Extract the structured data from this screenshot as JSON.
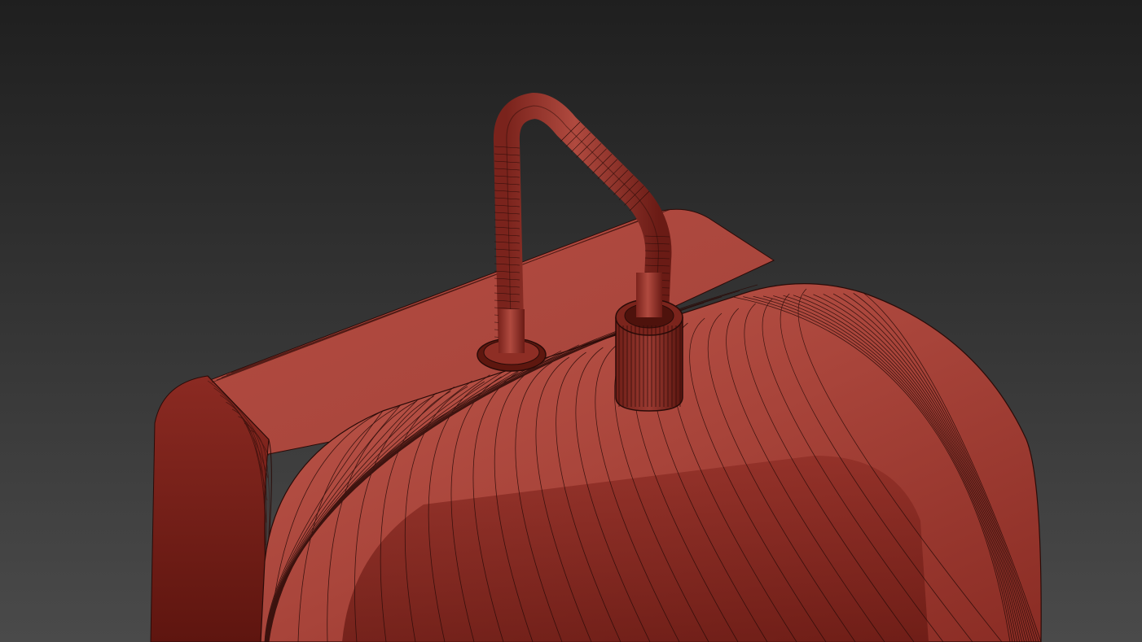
{
  "scene": {
    "subject": "wireframe-over-shaded-red-object-with-handle",
    "colors": {
      "background_top": "#1f1f1f",
      "background_bottom": "#4a4a4a",
      "body_light": "#b24a40",
      "body_mid": "#9b3a31",
      "body_dark": "#6a1914",
      "wire": "#2a0b08"
    }
  }
}
